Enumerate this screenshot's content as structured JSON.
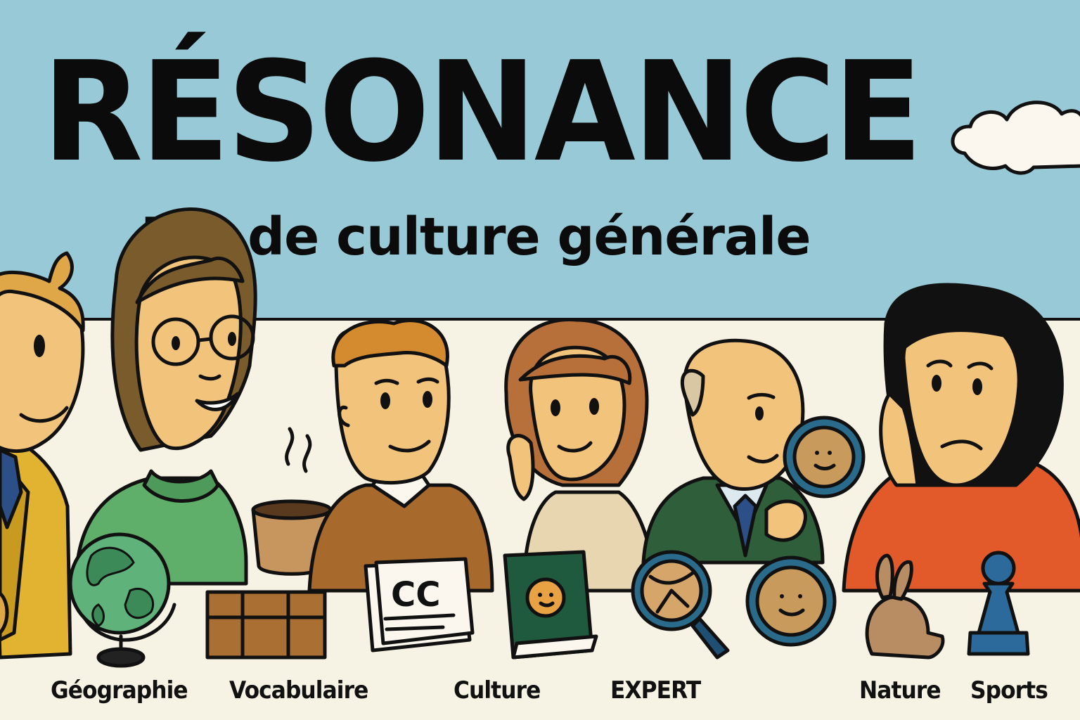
{
  "title": "RÉSONANCE",
  "subtitle": "Jeu de culture générale",
  "categories": {
    "geographie": "Géographie",
    "vocabulaire": "Vocabulaire",
    "culture": "Culture",
    "expert": "EXPERT",
    "nature": "Nature",
    "sports": "Sports"
  },
  "book_text": "CC",
  "colors": {
    "sky": "#97c9d7",
    "ground": "#f7f3e4",
    "outline": "#111111",
    "skin": "#f2c37a"
  }
}
